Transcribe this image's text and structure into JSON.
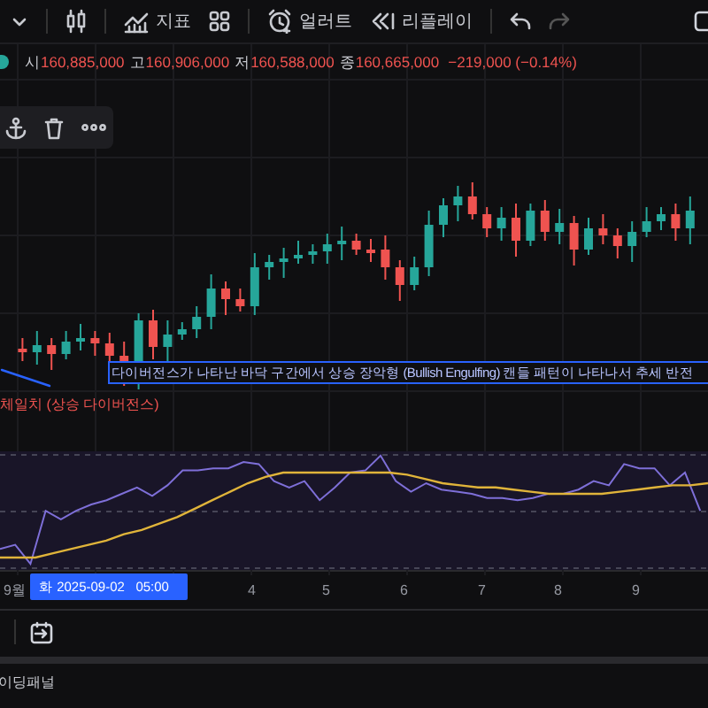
{
  "toolbar": {
    "items": [
      {
        "kind": "dropdown"
      },
      {
        "kind": "chart-type"
      },
      {
        "kind": "indicators",
        "label": "지표"
      },
      {
        "kind": "layouts"
      },
      {
        "kind": "alert",
        "label": "얼러트"
      },
      {
        "kind": "replay",
        "label": "리플레이"
      },
      {
        "kind": "undo"
      },
      {
        "kind": "redo"
      }
    ]
  },
  "ohlc": {
    "fields": [
      {
        "label": "시",
        "value": "160,885,000"
      },
      {
        "label": "고",
        "value": "160,906,000"
      },
      {
        "label": "저",
        "value": "160,588,000"
      },
      {
        "label": "종",
        "value": "160,665,000"
      }
    ],
    "change": "−219,000 (−0.14%)"
  },
  "drawing_toolbar": {
    "items": [
      {
        "kind": "anchor"
      },
      {
        "kind": "delete"
      },
      {
        "kind": "more"
      }
    ]
  },
  "annotations": [
    {
      "kind": "note",
      "text": "다이버전스가 나타난 바닥 구간에서 상승 장악형 (Bullish Engulfing) 캔들 패턴이 나타나서 추세 반전"
    },
    {
      "kind": "label",
      "text": "체일치 (상승 다이버전스)"
    }
  ],
  "time_axis": {
    "labels": [
      "9월",
      "4",
      "5",
      "6",
      "7",
      "8",
      "9"
    ],
    "crosshair": "화 2025-09-02   05:00"
  },
  "panel": {
    "title": "이딩패널"
  }
}
